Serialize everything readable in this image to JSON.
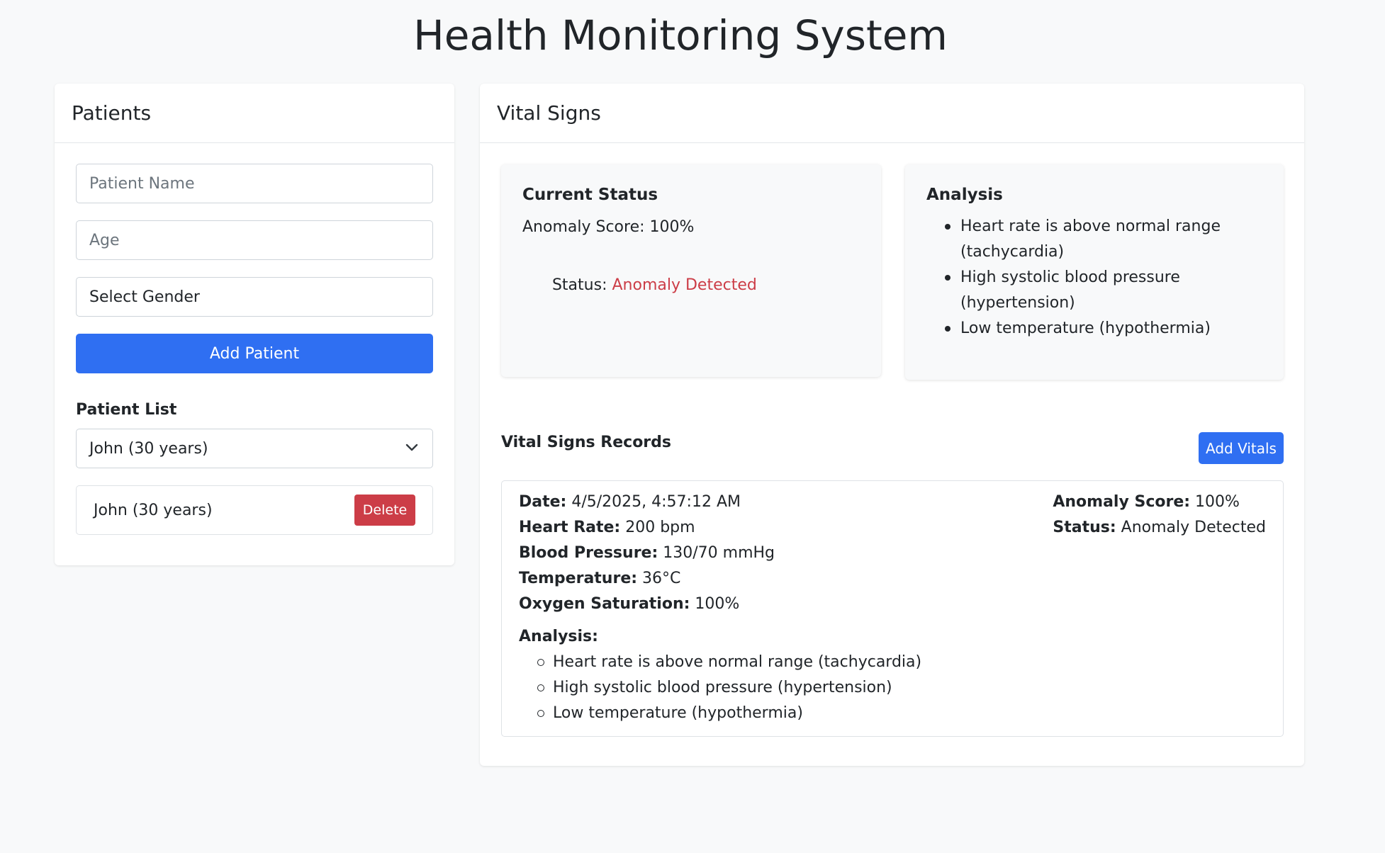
{
  "page": {
    "title": "Health Monitoring System"
  },
  "patients": {
    "header": "Patients",
    "name_placeholder": "Patient Name",
    "age_placeholder": "Age",
    "gender_select": "Select Gender",
    "add_button": "Add Patient",
    "list_label": "Patient List",
    "selected_patient": "John (30 years)",
    "items": [
      {
        "label": "John (30 years)",
        "delete_label": "Delete"
      }
    ]
  },
  "vitals": {
    "header": "Vital Signs",
    "current_status": {
      "title": "Current Status",
      "score_text": "Anomaly Score: 100%",
      "status_label": "Status: ",
      "status_value": "Anomaly Detected"
    },
    "analysis": {
      "title": "Analysis",
      "items": [
        "Heart rate is above normal range (tachycardia)",
        "High systolic blood pressure (hypertension)",
        "Low temperature (hypothermia)"
      ]
    },
    "records_title": "Vital Signs Records",
    "add_vitals_button": "Add Vitals",
    "records": [
      {
        "date_label": "Date:",
        "date": "4/5/2025, 4:57:12 AM",
        "hr_label": "Heart Rate:",
        "hr": "200 bpm",
        "bp_label": "Blood Pressure:",
        "bp": "130/70 mmHg",
        "temp_label": "Temperature:",
        "temp": "36°C",
        "o2_label": "Oxygen Saturation:",
        "o2": "100%",
        "score_label": "Anomaly Score:",
        "score": "100%",
        "status_label": "Status:",
        "status": "Anomaly Detected",
        "analysis_label": "Analysis:",
        "analysis": [
          "Heart rate is above normal range (tachycardia)",
          "High systolic blood pressure (hypertension)",
          "Low temperature (hypothermia)"
        ]
      }
    ]
  },
  "colors": {
    "primary": "#2f6ff2",
    "danger": "#cc3d47",
    "background": "#f8f9fa"
  }
}
